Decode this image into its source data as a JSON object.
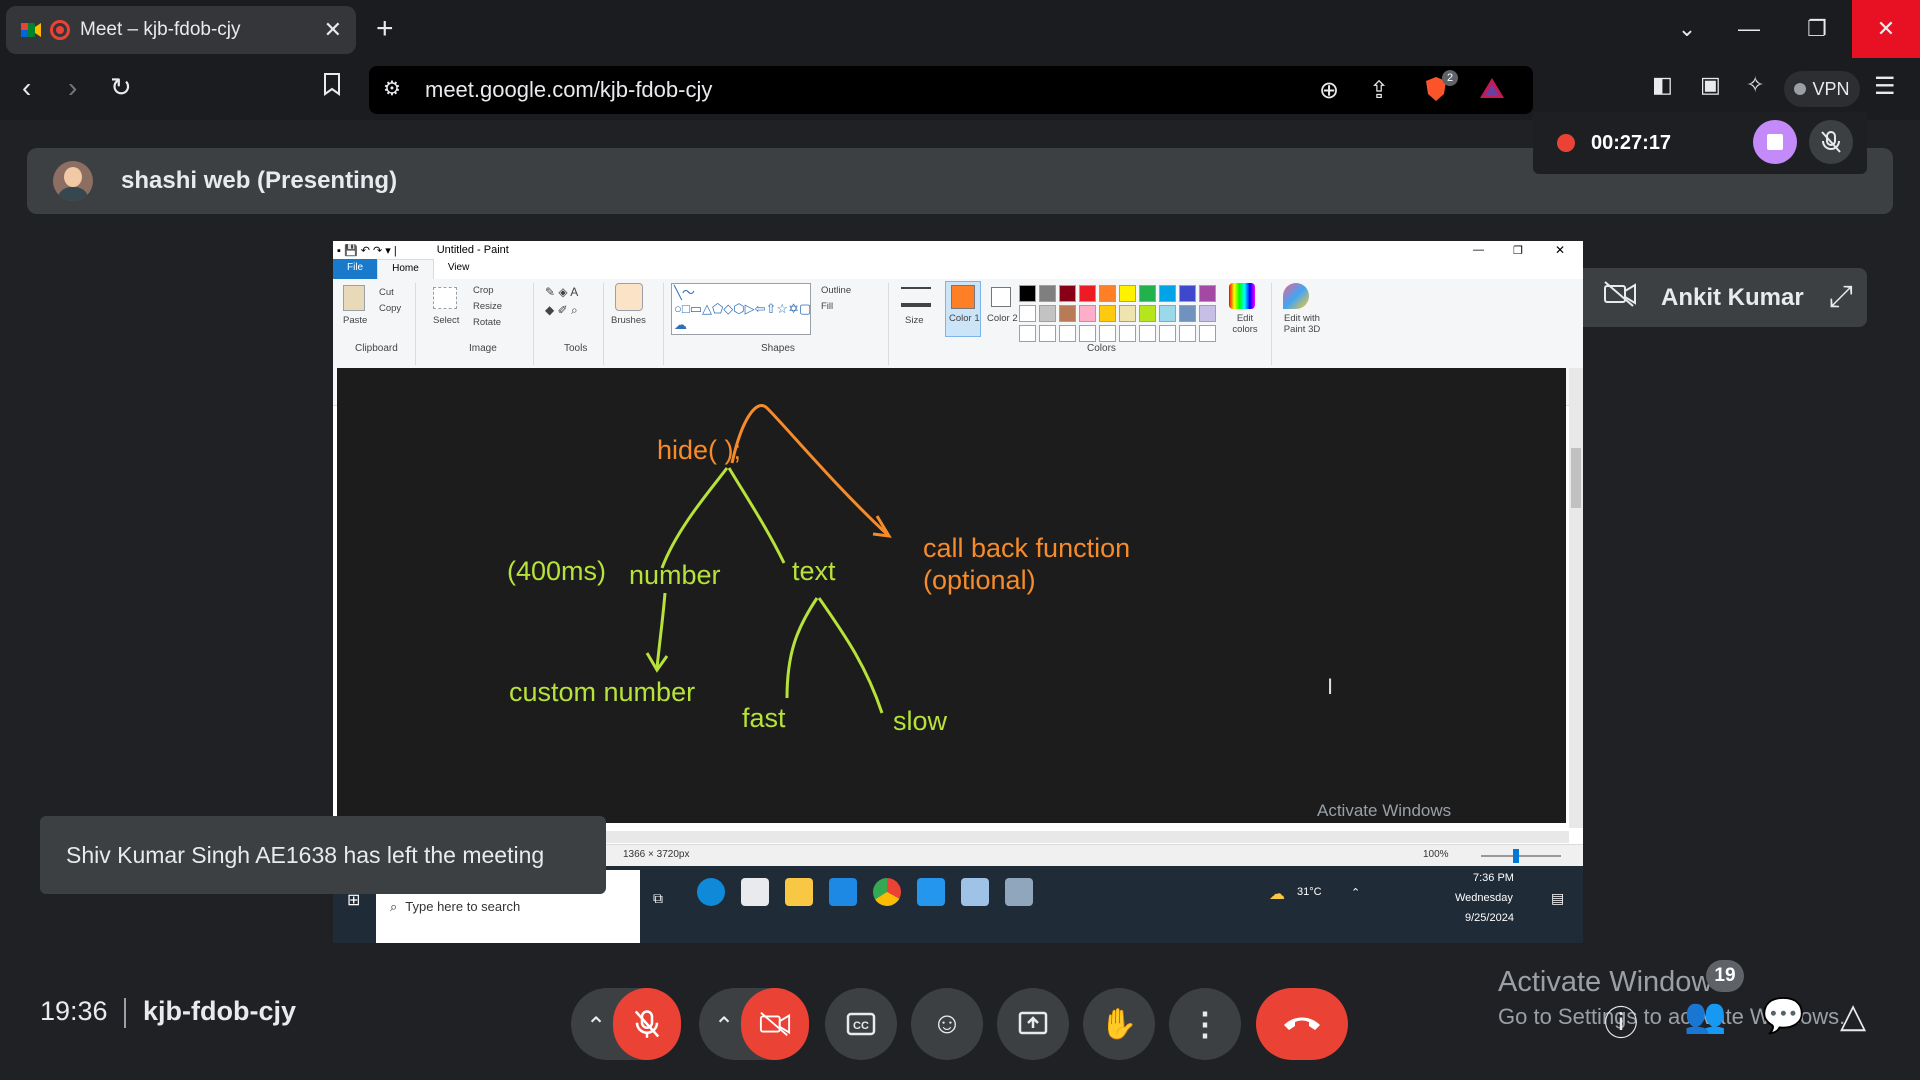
{
  "browser": {
    "tab_title": "Meet – kjb-fdob-cjy",
    "url": "meet.google.com/kjb-fdob-cjy",
    "brave_badge": "2",
    "vpn_label": "VPN"
  },
  "meet": {
    "presenter_banner": "shashi web (Presenting)",
    "recording_time": "00:27:17",
    "participant_tile_name": "Ankit Kumar",
    "toast_message": "Shiv Kumar Singh AE1638 has left the meeting",
    "clock": "19:36",
    "meeting_code": "kjb-fdob-cjy",
    "people_count": "19",
    "activate_windows_title": "Activate Windows",
    "activate_windows_sub": "Go to Settings to activate Windows."
  },
  "shared_screen": {
    "window_title": "Untitled - Paint",
    "menu_tabs": [
      "File",
      "Home",
      "View"
    ],
    "ribbon": {
      "clipboard": {
        "paste": "Paste",
        "cut": "Cut",
        "copy": "Copy",
        "group": "Clipboard"
      },
      "image": {
        "select": "Select",
        "crop": "Crop",
        "resize": "Resize",
        "rotate": "Rotate",
        "group": "Image"
      },
      "tools": {
        "group": "Tools"
      },
      "brushes": "Brushes",
      "shapes": {
        "outline": "Outline",
        "fill": "Fill",
        "group": "Shapes"
      },
      "size": "Size",
      "color1": "Color 1",
      "color2": "Color 2",
      "colors_group": "Colors",
      "edit_colors": "Edit colors",
      "edit_paint3d": "Edit with Paint 3D"
    },
    "palette_row1": [
      "#000000",
      "#7f7f7f",
      "#880015",
      "#ed1c24",
      "#ff7f27",
      "#fff200",
      "#22b14c",
      "#00a2e8",
      "#3f48cc",
      "#a349a4"
    ],
    "palette_row2": [
      "#ffffff",
      "#c3c3c3",
      "#b97a57",
      "#ffaec9",
      "#ffc90e",
      "#efe4b0",
      "#b5e61d",
      "#99d9ea",
      "#7092be",
      "#c8bfe7"
    ],
    "canvas_text": {
      "hide": "hide( );",
      "callback_line1": "call back function",
      "callback_line2": "(optional)",
      "ms": "(400ms)",
      "number": "number",
      "text": "text",
      "custom": "custom number",
      "fast": "fast",
      "slow": "slow"
    },
    "inner_activate": "Activate Windows",
    "status_dimensions": "1366 × 3720px",
    "zoom": "100%",
    "taskbar": {
      "search_placeholder": "Type here to search",
      "weather": "31°C",
      "time": "7:36 PM",
      "day": "Wednesday",
      "date": "9/25/2024"
    }
  },
  "colors": {
    "canvas_orange": "#f58b2a",
    "canvas_green": "#b7e23a",
    "hangup_red": "#ea4335",
    "stop_purple": "#c58af9"
  }
}
